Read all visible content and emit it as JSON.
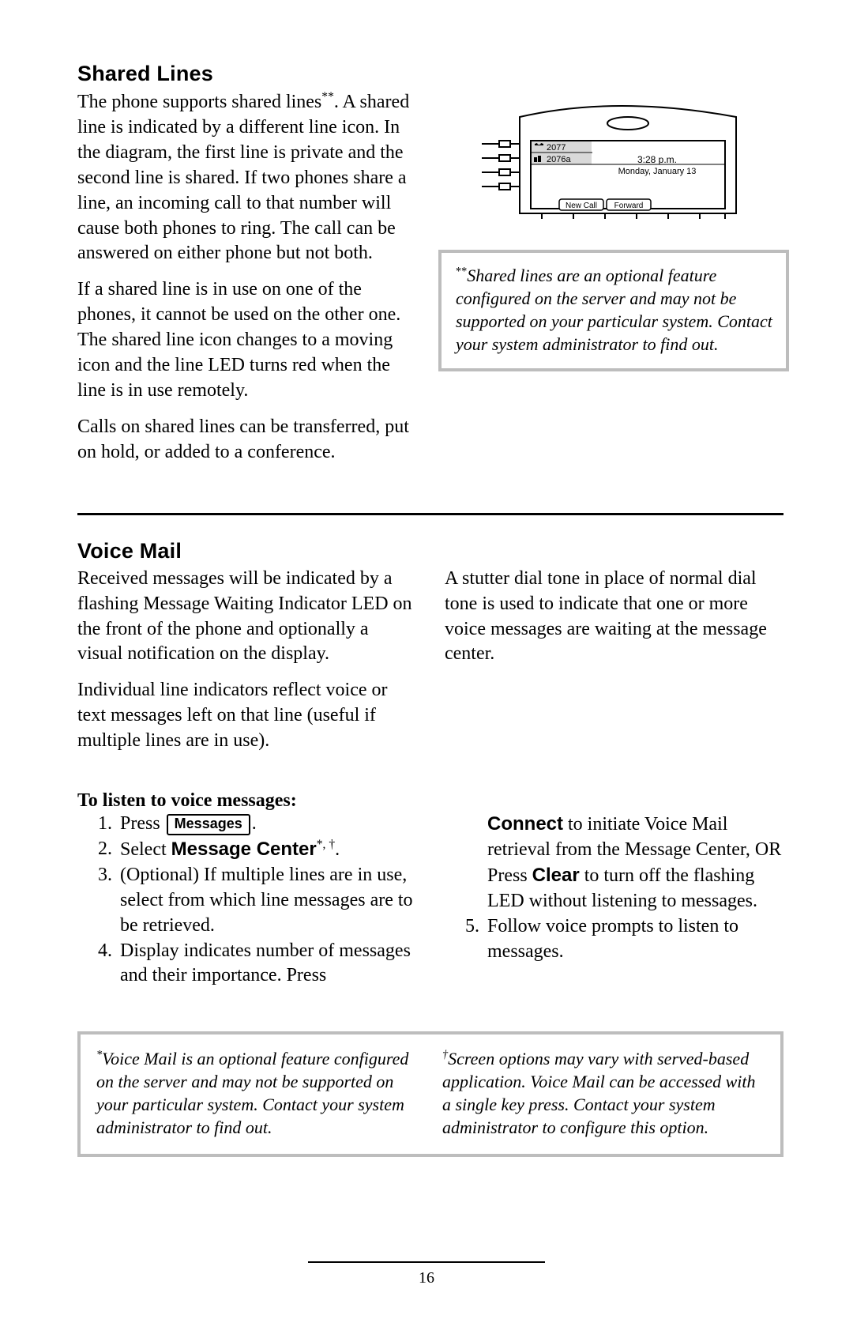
{
  "shared_lines": {
    "heading": "Shared Lines",
    "p1_a": "The phone supports shared lines",
    "p1_sup": "**",
    "p1_b": ".  A shared line is indicated by a different line icon.  In the diagram, the first line is private and the second line is shared.  If two phones share a line, an incoming call to that number will cause both phones to ring.  The call can be answered on either phone but not both.",
    "p2": "If a shared line is in use on one of the phones, it cannot be used on the other one.  The shared line icon changes to a moving icon and the line LED turns red when the line is in use remotely.",
    "p3": "Calls on shared lines can be transferred, put on hold, or added to a conference.",
    "note_sup": "**",
    "note": "Shared lines are an optional feature configured on the server and may not be supported on your particular system.  Contact your system administrator to find out."
  },
  "phone_screen": {
    "line1": "2077",
    "line2": "2076a",
    "time": "3:28 p.m.",
    "date": "Monday, January 13",
    "softkey1": "New Call",
    "softkey2": "Forward"
  },
  "voice_mail": {
    "heading": "Voice Mail",
    "left_p1": "Received messages will be indicated by a flashing Message Waiting Indicator LED on the front of the phone and optionally a visual notification on the display.",
    "left_p2": "Individual line indicators reflect voice or text messages left on that line (useful if multiple lines are in use).",
    "right_p1": "A stutter dial tone in place of normal dial tone is used to indicate that one or more voice messages are waiting at the message center.",
    "instructions_heading": "To listen to voice messages:",
    "steps": {
      "n1": "1.",
      "s1_a": "Press ",
      "s1_btn": "Messages",
      "s1_b": ".",
      "n2": "2.",
      "s2_a": "Select ",
      "s2_label": "Message Center",
      "s2_sup": "*, †",
      "s2_b": ".",
      "n3": "3.",
      "s3": "(Optional)  If multiple lines are in use, select from which line messages are to be retrieved.",
      "n4": "4.",
      "s4": "Display indicates number of messages and their importance.  Press",
      "s4c_label1": "Connect",
      "s4c_a": " to initiate Voice Mail retrieval from the Message Center, OR",
      "s4c_b_a": "Press ",
      "s4c_label2": "Clear",
      "s4c_b_b": " to turn off the flashing LED without listening to messages.",
      "n5": "5.",
      "s5": "Follow voice prompts to listen to messages."
    },
    "foot1_sup": "*",
    "foot1": "Voice Mail is an optional feature configured on the server and may not be supported on your particular system.  Contact your system administrator to find out.",
    "foot2_sup": "†",
    "foot2": "Screen options may vary with served-based application.  Voice Mail can be accessed with a single key press.  Contact your system administrator to configure this option."
  },
  "page_number": "16"
}
